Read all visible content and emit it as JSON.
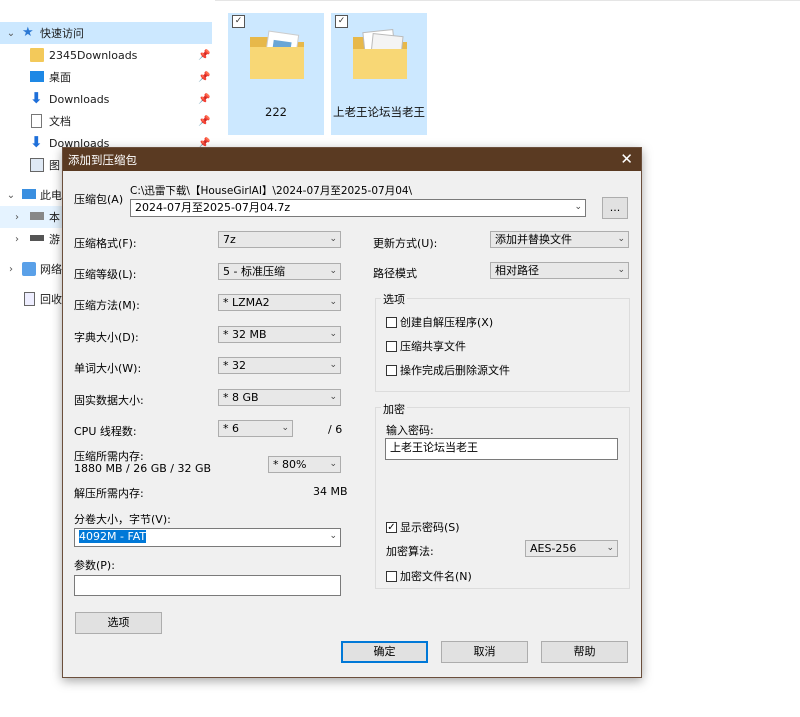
{
  "nav": {
    "quick_access": "快速访问",
    "items": [
      {
        "label": "2345Downloads",
        "icon": "folder-icon"
      },
      {
        "label": "桌面",
        "icon": "desktop-icon"
      },
      {
        "label": "Downloads",
        "icon": "download-icon"
      },
      {
        "label": "文档",
        "icon": "document-icon"
      },
      {
        "label": "Downloads",
        "icon": "download-icon"
      },
      {
        "label": "图",
        "icon": "picture-icon"
      }
    ],
    "this_pc": "此电",
    "this_pc_children": [
      "本",
      "游"
    ],
    "network": "网络",
    "recycle": "回收"
  },
  "files": [
    {
      "name": "222",
      "checked": true
    },
    {
      "name": "上老王论坛当老王",
      "checked": true
    }
  ],
  "dialog": {
    "title": "添加到压缩包",
    "archive_label": "压缩包(A)",
    "archive_path": "C:\\迅雷下载\\【HouseGirlAI】\\2024-07月至2025-07月04\\",
    "archive_name": "2024-07月至2025-07月04.7z",
    "browse_label": "...",
    "left": {
      "format_label": "压缩格式(F):",
      "format_value": "7z",
      "level_label": "压缩等级(L):",
      "level_value": "5 - 标准压缩",
      "method_label": "压缩方法(M):",
      "method_value": "* LZMA2",
      "dict_label": "字典大小(D):",
      "dict_value": "* 32 MB",
      "word_label": "单词大小(W):",
      "word_value": "* 32",
      "solid_label": "固实数据大小:",
      "solid_value": "* 8 GB",
      "cpu_label": "CPU 线程数:",
      "cpu_value": "* 6",
      "cpu_total": "/ 6",
      "mem_label": "压缩所需内存:",
      "mem_detail": "1880 MB / 26 GB / 32 GB",
      "mem_value": "* 80%",
      "decomp_label": "解压所需内存:",
      "decomp_value": "34 MB",
      "split_label": "分卷大小，字节(V):",
      "split_value": "4092M - FAT",
      "params_label": "参数(P):",
      "params_value": "",
      "options_button": "选项"
    },
    "right": {
      "update_label": "更新方式(U):",
      "update_value": "添加并替换文件",
      "path_label": "路径模式",
      "path_value": "相对路径",
      "options_group": "选项",
      "opt_sfx": "创建自解压程序(X)",
      "opt_shared": "压缩共享文件",
      "opt_delete": "操作完成后删除源文件",
      "enc_group": "加密",
      "pwd_label": "输入密码:",
      "pwd_value": "上老王论坛当老王",
      "show_pwd": "显示密码(S)",
      "enc_method_label": "加密算法:",
      "enc_method_value": "AES-256",
      "enc_names": "加密文件名(N)"
    },
    "ok": "确定",
    "cancel": "取消",
    "help": "帮助"
  }
}
